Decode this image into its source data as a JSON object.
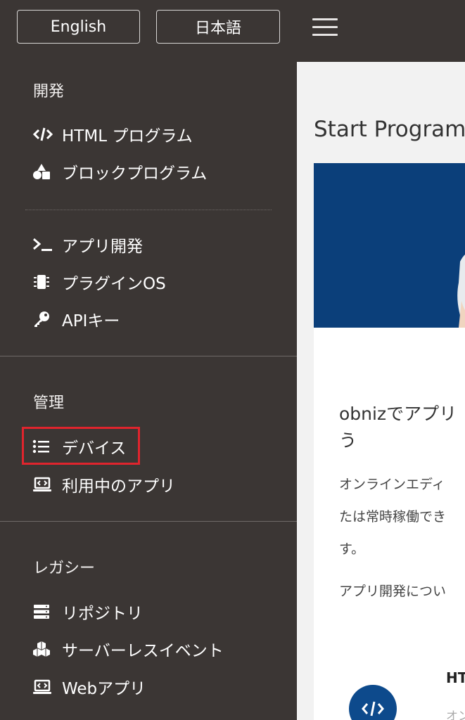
{
  "header": {
    "lang_english": "English",
    "lang_japanese": "日本語"
  },
  "sidebar": {
    "sections": {
      "dev": "開発",
      "manage": "管理",
      "legacy": "レガシー"
    },
    "items": {
      "html_program": "HTML プログラム",
      "block_program": "ブロックプログラム",
      "app_dev": "アプリ開発",
      "plugin_os": "プラグインOS",
      "api_key": "APIキー",
      "devices": "デバイス",
      "apps_in_use": "利用中のアプリ",
      "repository": "リポジトリ",
      "serverless_event": "サーバーレスイベント",
      "web_app": "Webアプリ"
    }
  },
  "main": {
    "title": "Start Program",
    "card": {
      "heading_line1": "obnizでアプリ",
      "heading_line2": "う",
      "para1_line1": "オンラインエディ",
      "para1_line2": "たは常時稼働でき",
      "para1_line3": "す。",
      "para2": "アプリ開発につい",
      "html_label": "HT",
      "html_sub": "オン"
    }
  },
  "colors": {
    "sidebar_bg": "#3b3634",
    "highlight": "#e0242d",
    "banner": "#0b3f7a"
  }
}
